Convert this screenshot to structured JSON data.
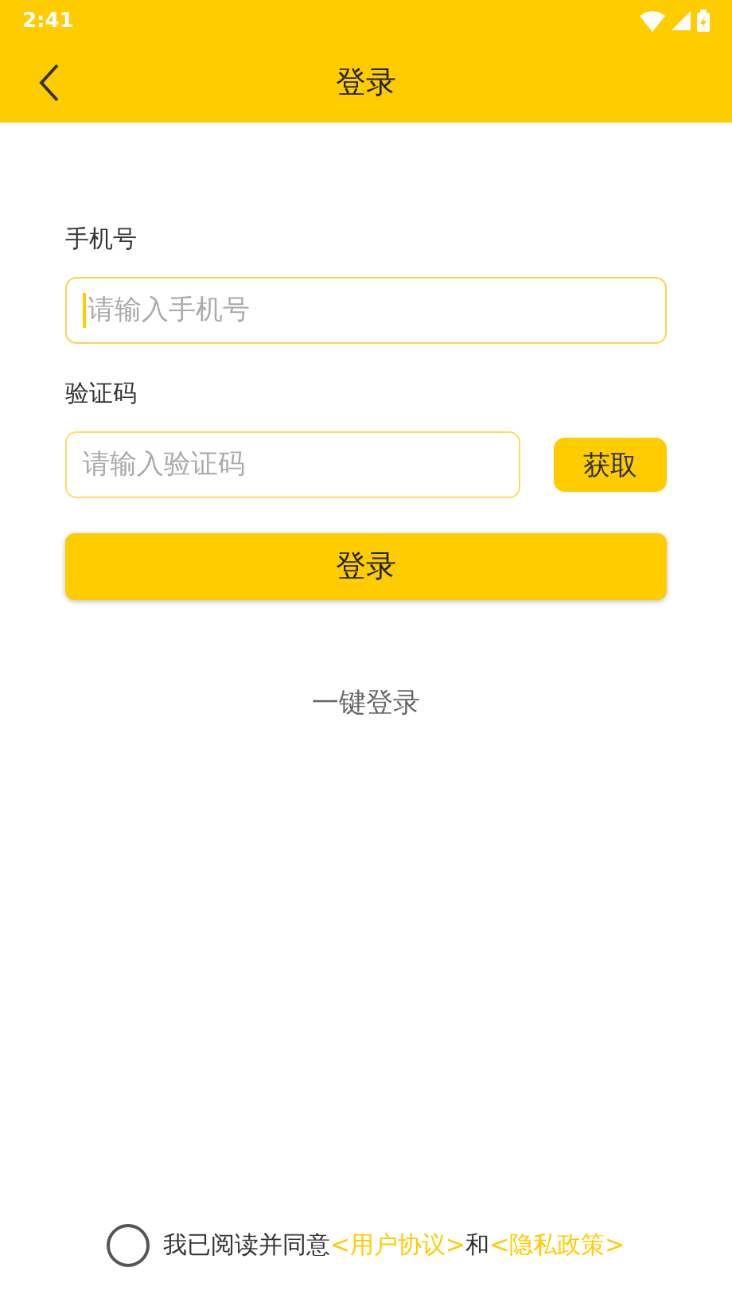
{
  "status_bar": {
    "time": "2:41"
  },
  "header": {
    "title": "登录"
  },
  "form": {
    "phone": {
      "label": "手机号",
      "placeholder": "请输入手机号",
      "focused": true
    },
    "code": {
      "label": "验证码",
      "placeholder": "请输入验证码",
      "focused": false,
      "get_button": "获取"
    },
    "login_button": "登录",
    "one_click_login": "一键登录"
  },
  "agreement": {
    "checked": false,
    "text": "我已阅读并同意",
    "user_link": "<用户协议>",
    "joiner": "和",
    "privacy_link": "<隐私政策>"
  }
}
